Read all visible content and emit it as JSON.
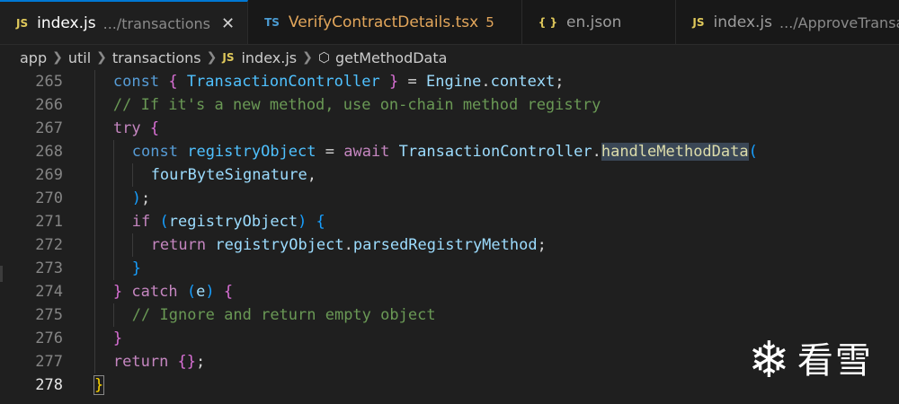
{
  "tabs": [
    {
      "icon": "JS",
      "name": "index.js",
      "path": ".../transactions",
      "close": "✕"
    },
    {
      "icon": "TS",
      "name": "VerifyContractDetails.tsx",
      "badge": "5"
    },
    {
      "icon": "{ }",
      "name": "en.json"
    },
    {
      "icon": "JS",
      "name": "index.js",
      "path": ".../ApproveTransactionRe"
    }
  ],
  "breadcrumb": {
    "items": [
      "app",
      "util",
      "transactions"
    ],
    "file_icon": "JS",
    "file": "index.js",
    "symbol": "getMethodData"
  },
  "editor": {
    "current_line": "278",
    "lines": [
      {
        "n": "265",
        "indent": "  ",
        "tokens": [
          [
            "const ",
            "dk"
          ],
          [
            "{",
            "br2"
          ],
          [
            " ",
            "pn"
          ],
          [
            "TransactionController",
            "cst"
          ],
          [
            " ",
            "pn"
          ],
          [
            "}",
            "br2"
          ],
          [
            " = ",
            "pn"
          ],
          [
            "Engine",
            "var"
          ],
          [
            ".",
            "pn"
          ],
          [
            "context",
            "var"
          ],
          [
            ";",
            "pn"
          ]
        ]
      },
      {
        "n": "266",
        "indent": "  ",
        "tokens": [
          [
            "// If it's a new method, use on-chain method registry",
            "cm"
          ]
        ]
      },
      {
        "n": "267",
        "indent": "  ",
        "tokens": [
          [
            "try ",
            "kw"
          ],
          [
            "{",
            "br2"
          ]
        ]
      },
      {
        "n": "268",
        "indent": "    ",
        "tokens": [
          [
            "const ",
            "dk"
          ],
          [
            "registryObject",
            "cst"
          ],
          [
            " = ",
            "pn"
          ],
          [
            "await ",
            "kw"
          ],
          [
            "TransactionController",
            "var"
          ],
          [
            ".",
            "pn"
          ],
          [
            "handleMethodData",
            "fn hl"
          ],
          [
            "(",
            "br3"
          ]
        ]
      },
      {
        "n": "269",
        "indent": "      ",
        "tokens": [
          [
            "fourByteSignature",
            "var"
          ],
          [
            ",",
            "pn"
          ]
        ]
      },
      {
        "n": "270",
        "indent": "    ",
        "tokens": [
          [
            ")",
            "br3"
          ],
          [
            ";",
            "pn"
          ]
        ]
      },
      {
        "n": "271",
        "indent": "    ",
        "tokens": [
          [
            "if ",
            "kw"
          ],
          [
            "(",
            "br3"
          ],
          [
            "registryObject",
            "var"
          ],
          [
            ") ",
            "br3"
          ],
          [
            "{",
            "br3"
          ]
        ]
      },
      {
        "n": "272",
        "indent": "      ",
        "tokens": [
          [
            "return ",
            "kw"
          ],
          [
            "registryObject",
            "var"
          ],
          [
            ".",
            "pn"
          ],
          [
            "parsedRegistryMethod",
            "var"
          ],
          [
            ";",
            "pn"
          ]
        ]
      },
      {
        "n": "273",
        "indent": "    ",
        "tokens": [
          [
            "}",
            "br3"
          ]
        ]
      },
      {
        "n": "274",
        "indent": "  ",
        "tokens": [
          [
            "}",
            "br2"
          ],
          [
            " ",
            "pn"
          ],
          [
            "catch ",
            "kw"
          ],
          [
            "(",
            "br3"
          ],
          [
            "e",
            "var"
          ],
          [
            ")",
            "br3"
          ],
          [
            " ",
            "pn"
          ],
          [
            "{",
            "br2"
          ]
        ]
      },
      {
        "n": "275",
        "indent": "    ",
        "tokens": [
          [
            "// Ignore and return empty object",
            "cm"
          ]
        ]
      },
      {
        "n": "276",
        "indent": "  ",
        "tokens": [
          [
            "}",
            "br2"
          ]
        ]
      },
      {
        "n": "277",
        "indent": "  ",
        "tokens": [
          [
            "return ",
            "kw"
          ],
          [
            "{}",
            "br2"
          ],
          [
            ";",
            "pn"
          ]
        ]
      },
      {
        "n": "278",
        "indent": "",
        "tokens": [
          [
            "}",
            "br1"
          ]
        ]
      }
    ]
  },
  "watermark": {
    "icon": "snowflake-icon",
    "text": "看雪"
  },
  "colors": {
    "accent": "#0078d4",
    "background": "#1f1f1f",
    "tab_bar": "#181818",
    "modified": "#e2a65b"
  }
}
